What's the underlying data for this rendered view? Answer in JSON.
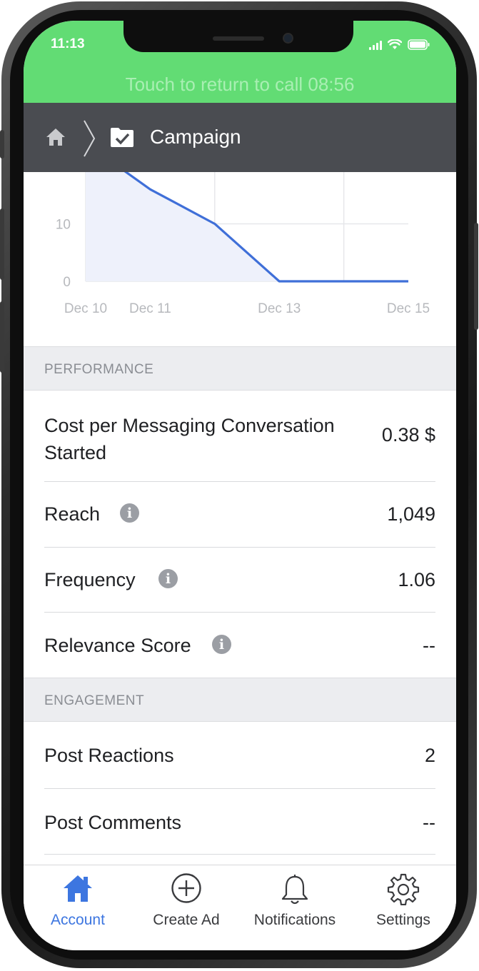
{
  "status_bar": {
    "time": "11:13"
  },
  "call_bar": {
    "text": "Touch to return to call 08:56"
  },
  "nav": {
    "title": "Campaign"
  },
  "chart_data": {
    "type": "area",
    "x": [
      "Dec 10",
      "Dec 11",
      "Dec 12",
      "Dec 13",
      "Dec 14",
      "Dec 15"
    ],
    "x_tick_labels": [
      "Dec 10",
      "Dec 11",
      "Dec 13",
      "Dec 15"
    ],
    "series": [
      {
        "values": [
          24,
          16,
          10,
          0,
          0,
          0
        ]
      }
    ],
    "y_tick_labels": [
      "10",
      "0"
    ],
    "ylim": [
      0,
      19
    ],
    "grid": true,
    "line_color": "#3f6fd8",
    "fill_color": "#eef1fb"
  },
  "performance": {
    "header": "PERFORMANCE",
    "rows": [
      {
        "label": "Cost per Messaging Conversation",
        "label2": "Started",
        "value": "0.38 $"
      },
      {
        "label": "Reach",
        "value": "1,049"
      },
      {
        "label": "Frequency",
        "value": "1.06"
      },
      {
        "label": "Relevance Score",
        "value": "--"
      }
    ]
  },
  "engagement": {
    "header": "ENGAGEMENT",
    "rows": [
      {
        "label": "Post Reactions",
        "value": "2"
      },
      {
        "label": "Post Comments",
        "value": "--"
      }
    ]
  },
  "tabs": [
    {
      "label": "Account",
      "icon": "home-icon",
      "active": true
    },
    {
      "label": "Create Ad",
      "icon": "plus-circle-icon"
    },
    {
      "label": "Notifications",
      "icon": "bell-icon"
    },
    {
      "label": "Settings",
      "icon": "gear-icon"
    }
  ],
  "colors": {
    "call_bar": "#62dc74",
    "nav_bg": "#4a4c51",
    "accent": "#3d76e0"
  }
}
